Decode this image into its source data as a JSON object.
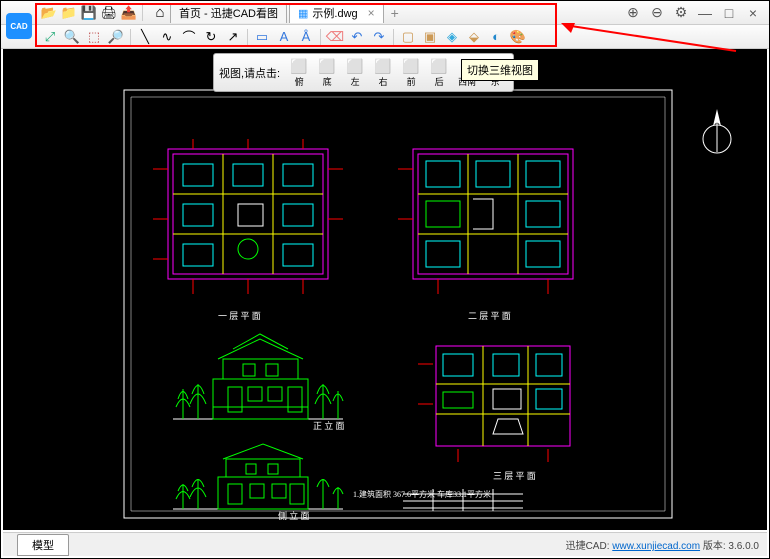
{
  "app": {
    "name": "CAD"
  },
  "titlebar": {
    "icons": [
      "open",
      "folder",
      "save",
      "print",
      "export"
    ],
    "home_icon": "⌂",
    "home_label": "首页 - 迅捷CAD看图",
    "file_icon_color": "#1e90ff",
    "file_tab_label": "示例.dwg",
    "close": "×",
    "add": "+"
  },
  "winctrl": {
    "zoom_in": "⊕",
    "zoom_out": "⊖",
    "settings": "⚙",
    "min": "—",
    "max": "□",
    "close": "×"
  },
  "toolbar": {
    "groups": [
      [
        "fit",
        "zoom-region",
        "zoom-window",
        "zoom"
      ],
      [
        "line",
        "polyline",
        "arc",
        "circle",
        "arrow"
      ],
      [
        "layer",
        "text",
        "dimension"
      ],
      [
        "erase",
        "undo",
        "redo"
      ],
      [
        "box",
        "boxes",
        "cube",
        "wireframe",
        "render",
        "palette"
      ]
    ]
  },
  "view_panel": {
    "label": "视图,请点击:",
    "buttons": [
      {
        "icon": "⬜",
        "label": "俯"
      },
      {
        "icon": "⬜",
        "label": "底"
      },
      {
        "icon": "⬜",
        "label": "左"
      },
      {
        "icon": "⬜",
        "label": "右"
      },
      {
        "icon": "⬜",
        "label": "前"
      },
      {
        "icon": "⬜",
        "label": "后"
      },
      {
        "icon": "◈",
        "label": "西南"
      },
      {
        "icon": "◈",
        "label": "东"
      }
    ]
  },
  "tooltip": "切换三维视图",
  "drawing": {
    "labels": {
      "fp1": "一 层 平 面",
      "fp2": "二 层 平 面",
      "fp3": "三 层 平 面",
      "elev1": "正 立 面",
      "elev2": "侧 立 面"
    },
    "bottom": "1.建筑面积   367.6平方米  车库33.1平方米"
  },
  "tabbar": {
    "model": "模型"
  },
  "status": {
    "prefix": "迅捷CAD: ",
    "url": "www.xunjiecad.com",
    "version_label": " 版本: ",
    "version": "3.6.0.0"
  }
}
